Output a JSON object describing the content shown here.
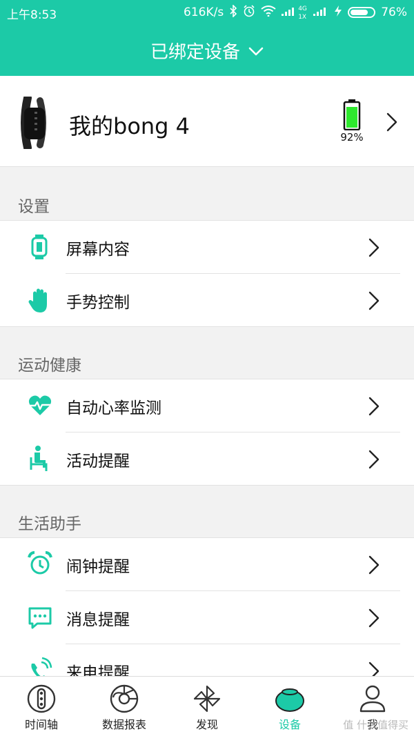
{
  "status_bar": {
    "time": "上午8:53",
    "network_speed": "616K/s",
    "battery_percent": "76%",
    "icons": [
      "bluetooth-icon",
      "alarm-icon",
      "wifi-icon",
      "signal-4g-icon",
      "signal-icon",
      "charging-icon",
      "battery-icon"
    ],
    "small_4g": "4G",
    "small_1x": "1X"
  },
  "header": {
    "title": "已绑定设备"
  },
  "device": {
    "name": "我的bong 4",
    "battery_label": "92%",
    "battery_level": 0.92,
    "battery_color": "#2ee82e"
  },
  "sections": [
    {
      "title": "设置",
      "items": [
        {
          "label": "屏幕内容",
          "icon": "watch-screen-icon"
        },
        {
          "label": "手势控制",
          "icon": "hand-gesture-icon"
        }
      ]
    },
    {
      "title": "运动健康",
      "items": [
        {
          "label": "自动心率监测",
          "icon": "heart-rate-icon"
        },
        {
          "label": "活动提醒",
          "icon": "sitting-person-icon"
        }
      ]
    },
    {
      "title": "生活助手",
      "items": [
        {
          "label": "闹钟提醒",
          "icon": "alarm-clock-icon"
        },
        {
          "label": "消息提醒",
          "icon": "message-icon"
        },
        {
          "label": "来电提醒",
          "icon": "phone-call-icon"
        }
      ]
    }
  ],
  "tabs": [
    {
      "label": "时间轴",
      "icon": "timeline-icon",
      "active": false
    },
    {
      "label": "数据报表",
      "icon": "data-report-icon",
      "active": false
    },
    {
      "label": "发现",
      "icon": "pinwheel-icon",
      "active": false
    },
    {
      "label": "设备",
      "icon": "device-icon",
      "active": true
    },
    {
      "label": "我",
      "icon": "profile-icon",
      "active": false
    }
  ],
  "watermark": "值 什么值得买",
  "colors": {
    "accent": "#1ccaa7"
  }
}
